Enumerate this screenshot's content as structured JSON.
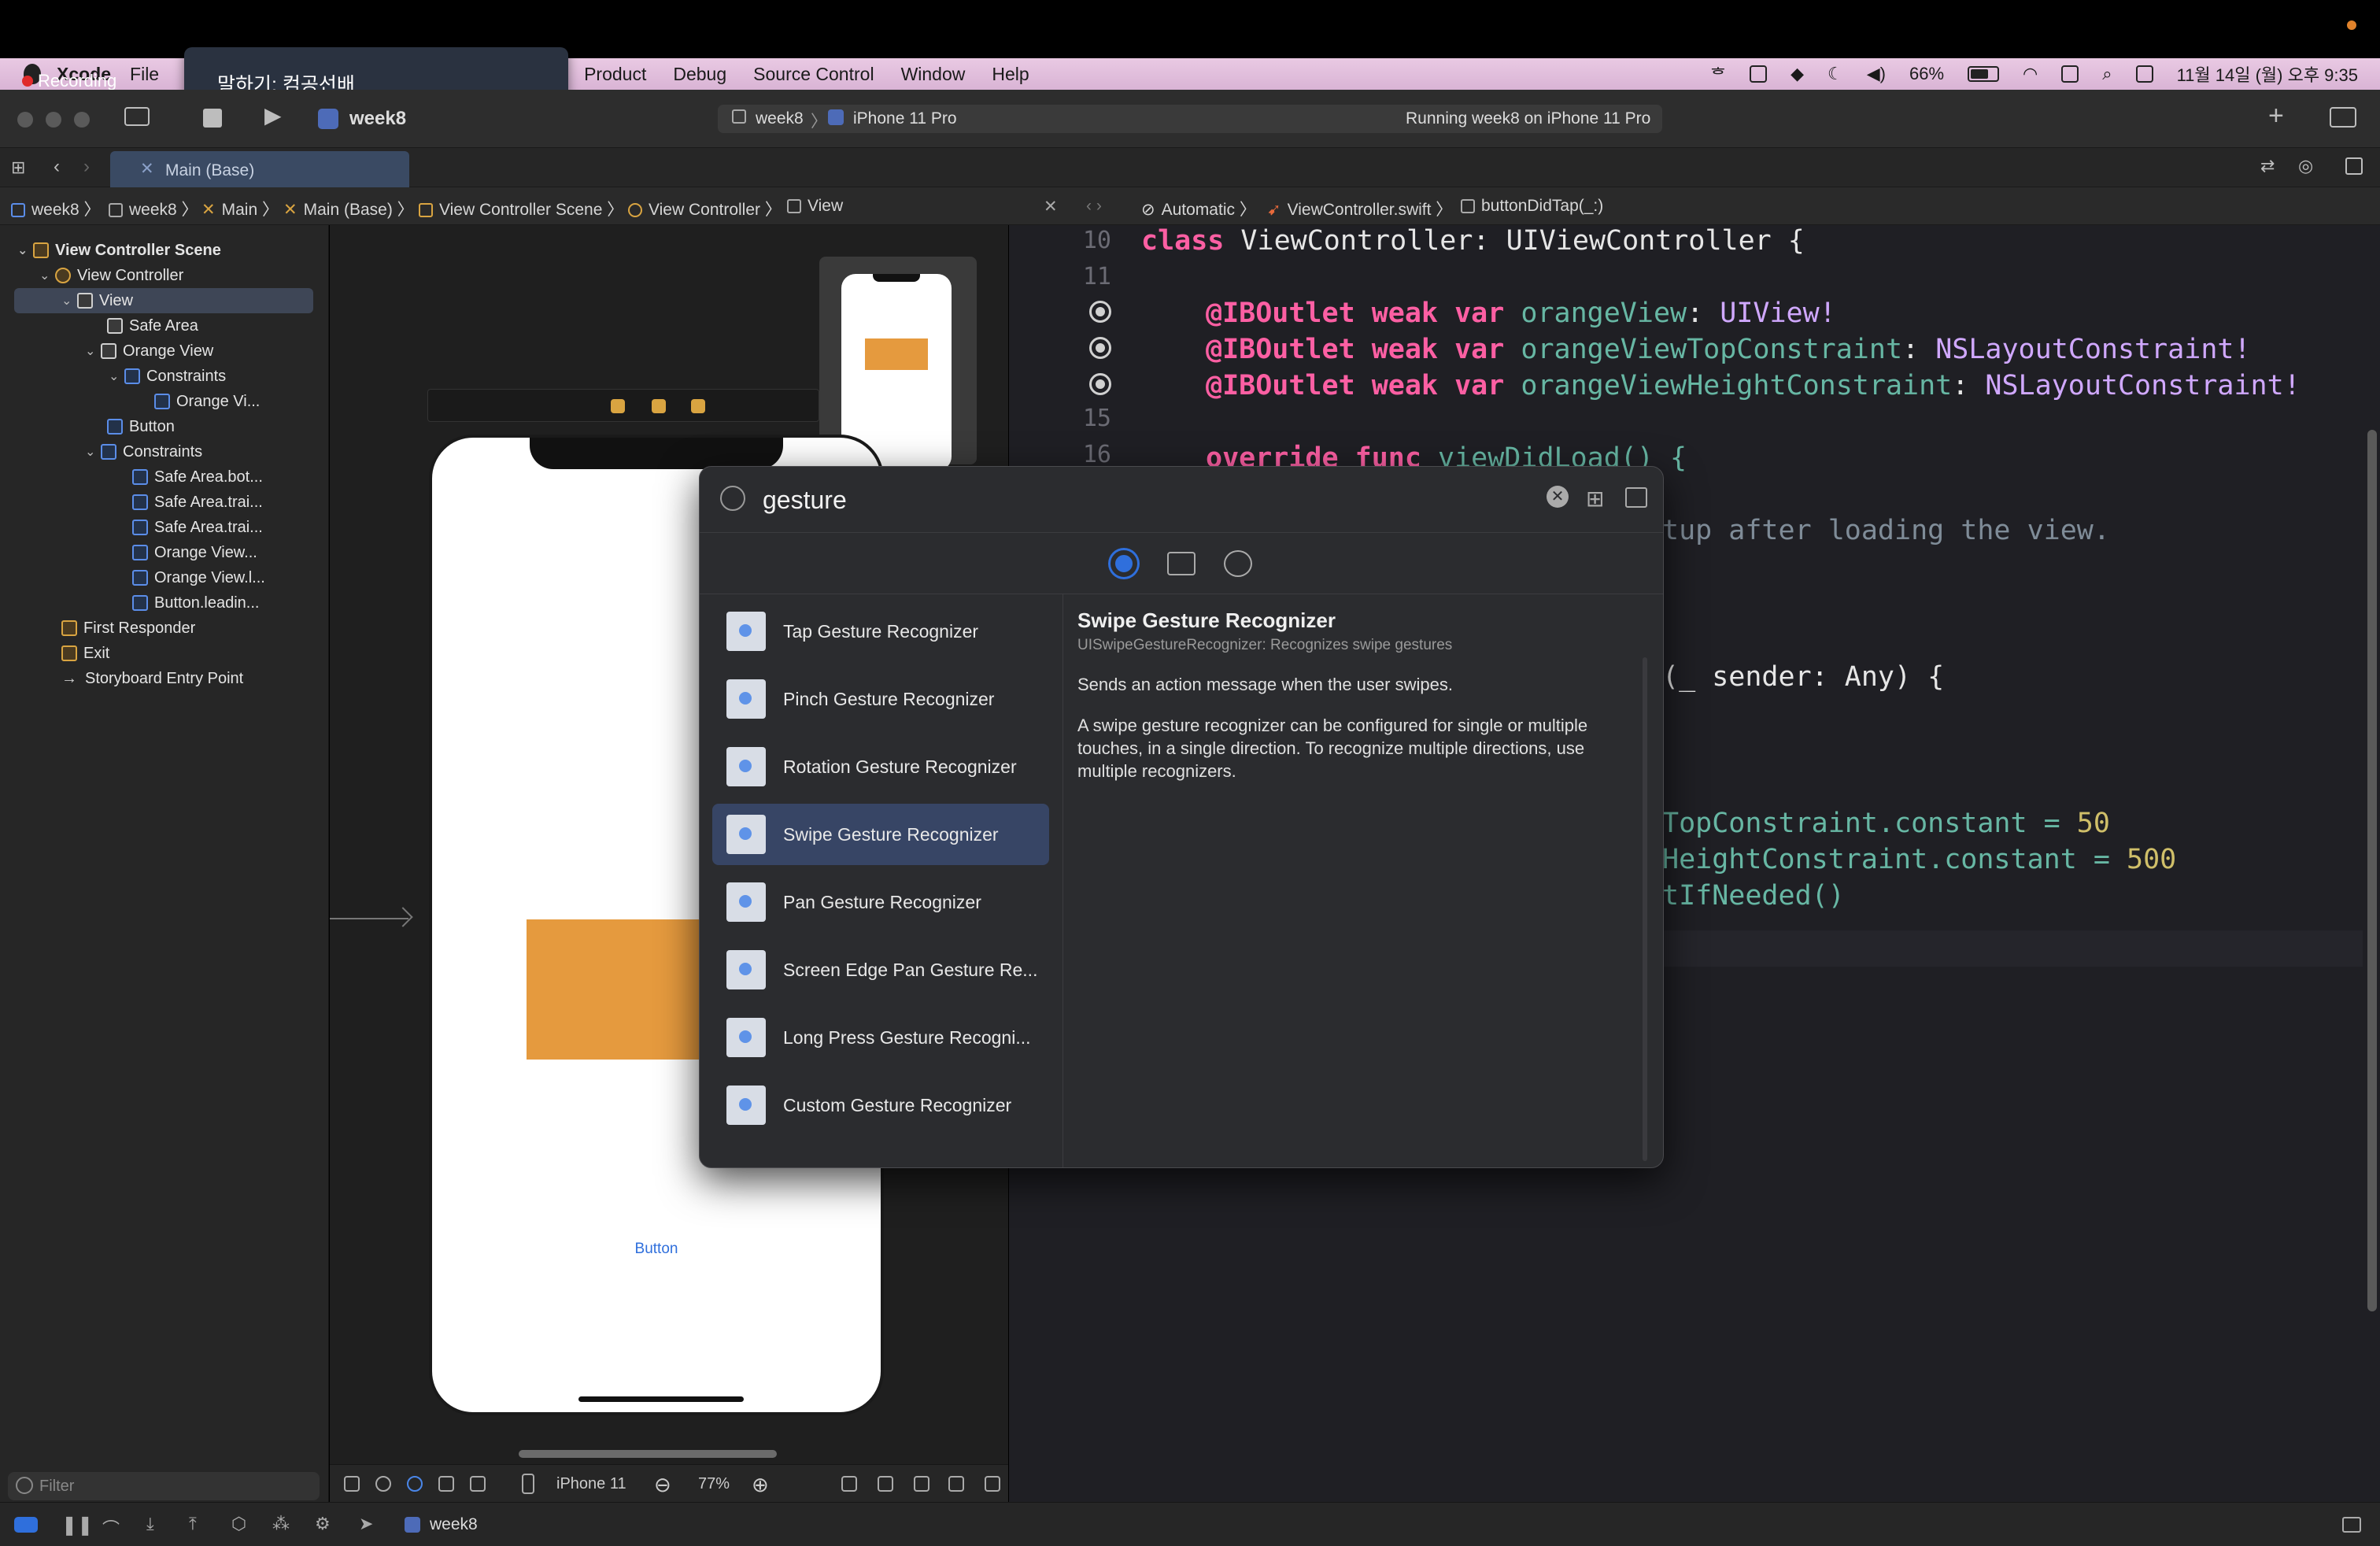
{
  "menubar": {
    "app_name": "Xcode",
    "items": [
      "File",
      "Product",
      "Debug",
      "Source Control",
      "Window",
      "Help"
    ],
    "battery": "66%",
    "clock": "11월 14일 (월) 오후 9:35"
  },
  "recording": {
    "label": "Recording"
  },
  "tooltip": {
    "text": "말하기: 컴공선배"
  },
  "toolbar": {
    "project": "week8",
    "scheme": "week8",
    "device": "iPhone 11 Pro",
    "status": "Running week8 on iPhone 11 Pro"
  },
  "tab": {
    "label": "Main (Base)"
  },
  "breadcrumb": {
    "left": [
      "week8",
      "week8",
      "Main",
      "Main (Base)",
      "View Controller Scene",
      "View Controller",
      "View"
    ],
    "right": [
      "Automatic",
      "ViewController.swift",
      "buttonDidTap(_:)"
    ]
  },
  "navigator": {
    "rows": [
      {
        "label": "View Controller Scene",
        "bold": true
      },
      {
        "label": "View Controller"
      },
      {
        "label": "View"
      },
      {
        "label": "Safe Area"
      },
      {
        "label": "Orange View"
      },
      {
        "label": "Constraints"
      },
      {
        "label": "Orange Vi..."
      },
      {
        "label": "Button"
      },
      {
        "label": "Constraints"
      },
      {
        "label": "Safe Area.bot..."
      },
      {
        "label": "Safe Area.trai..."
      },
      {
        "label": "Safe Area.trai..."
      },
      {
        "label": "Orange View..."
      },
      {
        "label": "Orange View.l..."
      },
      {
        "label": "Button.leadin..."
      },
      {
        "label": "First Responder"
      },
      {
        "label": "Exit"
      },
      {
        "label": "Storyboard Entry Point"
      }
    ],
    "filter_placeholder": "Filter"
  },
  "canvas": {
    "button_label": "Button",
    "device_label": "iPhone 11",
    "zoom": "77%"
  },
  "editor": {
    "line_numbers": [
      "10",
      "11",
      "",
      "",
      "",
      "15",
      "16"
    ],
    "lines": {
      "l10_kw": "class",
      "l10_rest": " ViewController: UIViewController {",
      "outlet1_name": "orangeView",
      "outlet1_type": "UIView!",
      "outlet2_name": "orangeViewTopConstraint",
      "outlet2_type": "NSLayoutConstraint!",
      "outlet3_name": "orangeViewHeightConstraint",
      "outlet3_type": "NSLayoutConstraint!",
      "outlet_prefix": "@IBOutlet weak var ",
      "l16_kw": "override func",
      "l16_rest": " viewDidLoad() {",
      "comment_tail": "tup after loading the view.",
      "sender_tail": "(_ sender: Any) {",
      "top_tail": "TopConstraint.constant = ",
      "top_value": "50",
      "height_tail": "HeightConstraint.constant = ",
      "height_value": "500",
      "layout_tail": "tIfNeeded()"
    }
  },
  "library": {
    "search_value": "gesture",
    "items": [
      "Tap Gesture Recognizer",
      "Pinch Gesture Recognizer",
      "Rotation Gesture Recognizer",
      "Swipe Gesture Recognizer",
      "Pan Gesture Recognizer",
      "Screen Edge Pan Gesture Re...",
      "Long Press Gesture Recogni...",
      "Custom Gesture Recognizer"
    ],
    "selected_index": 3,
    "detail": {
      "title": "Swipe Gesture Recognizer",
      "subtitle": "UISwipeGestureRecognizer: Recognizes swipe gestures",
      "summary": "Sends an action message when the user swipes.",
      "description": "A swipe gesture recognizer can be configured for single or multiple touches, in a single direction. To recognize multiple directions, use multiple recognizers."
    }
  },
  "debugbar": {
    "target": "week8"
  }
}
